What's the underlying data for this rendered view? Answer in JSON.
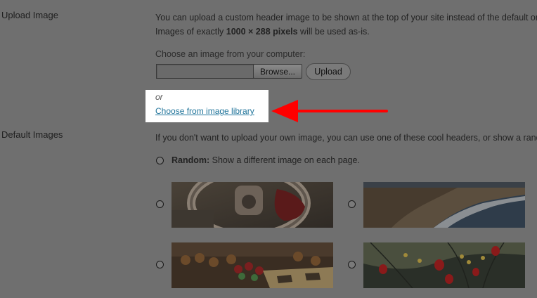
{
  "upload": {
    "section_label": "Upload Image",
    "desc_line1": "You can upload a custom header image to be shown at the top of your site instead of the default one",
    "desc_line2_prefix": "Images of exactly ",
    "desc_line2_bold": "1000 × 288 pixels",
    "desc_line2_suffix": " will be used as-is.",
    "choose_label": "Choose an image from your computer:",
    "browse_label": "Browse...",
    "upload_label": "Upload",
    "or_text": "or",
    "library_link": "Choose from image library"
  },
  "defaults": {
    "section_label": "Default Images",
    "desc": "If you don't want to upload your own image, you can use one of these cool headers, or show a rando",
    "random_bold": "Random:",
    "random_text": " Show a different image on each page.",
    "images": [
      {
        "name": "wheel"
      },
      {
        "name": "shore"
      },
      {
        "name": "chessboard"
      },
      {
        "name": "lanterns"
      }
    ]
  },
  "colors": {
    "overlay_bg": "#6f6f6f",
    "highlight": "#ffffff",
    "link": "#21759b",
    "arrow": "#ff0000"
  }
}
